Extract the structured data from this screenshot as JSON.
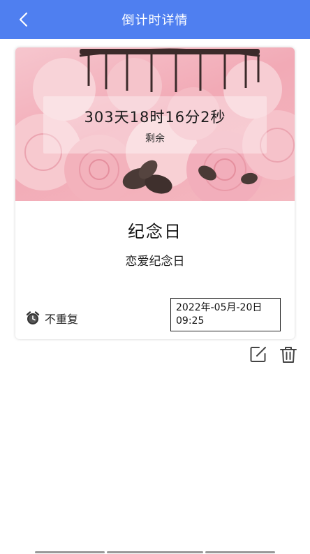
{
  "header": {
    "title": "倒计时详情",
    "background": "#4f7ff0"
  },
  "card": {
    "countdown": "303天18时16分2秒",
    "remaining_label": "剩余",
    "title": "纪念日",
    "subtitle": "恋爱纪念日",
    "repeat": {
      "icon": "alarm-clock-icon",
      "label": "不重复"
    },
    "datetime": {
      "date": "2022年-05月-20日",
      "time": "09:25"
    }
  },
  "actions": {
    "edit_icon": "edit-icon",
    "delete_icon": "trash-icon"
  }
}
